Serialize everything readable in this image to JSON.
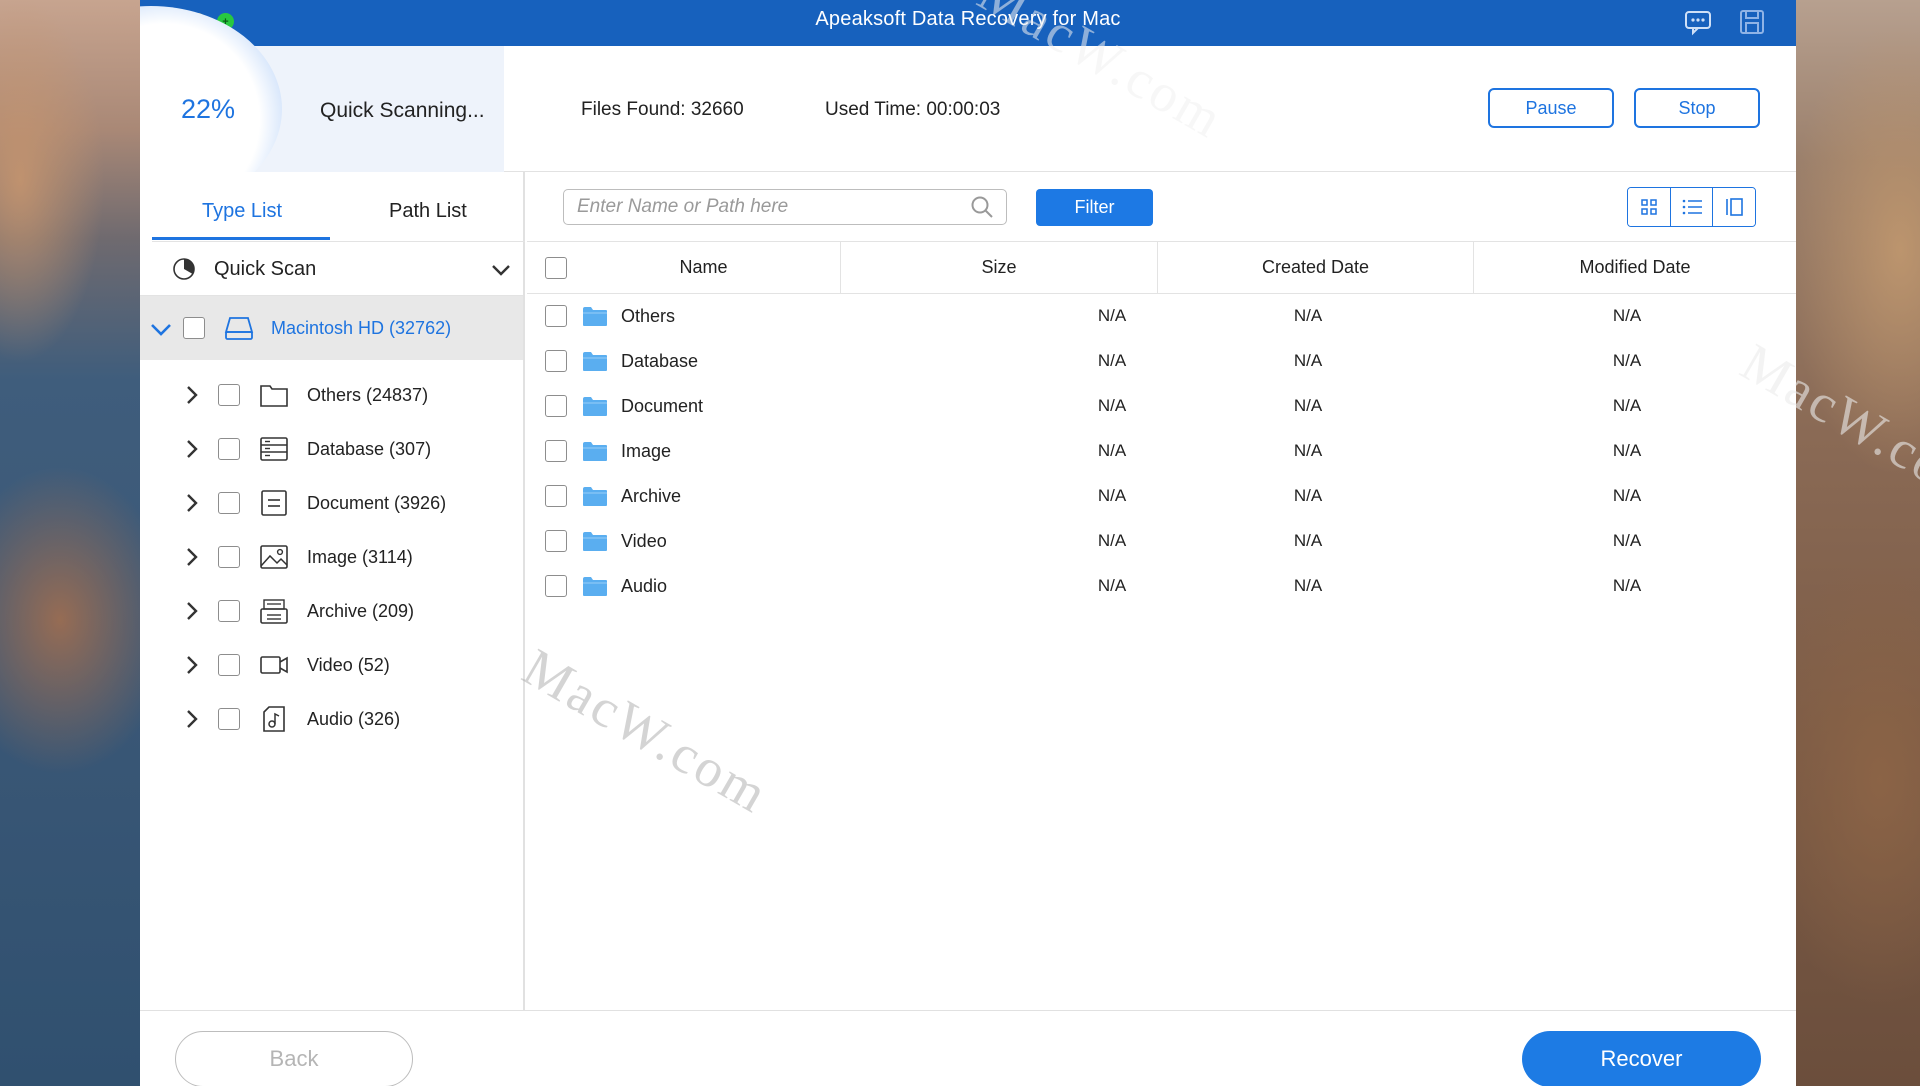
{
  "window": {
    "title": "Apeaksoft Data Recovery for Mac"
  },
  "scan": {
    "percent": "22%",
    "progress_fraction": 0.22,
    "status": "Quick Scanning...",
    "files_found": "Files Found: 32660",
    "used_time": "Used Time: 00:00:03",
    "pause_label": "Pause",
    "stop_label": "Stop"
  },
  "sidebar": {
    "tabs": [
      {
        "label": "Type List",
        "active": true
      },
      {
        "label": "Path List",
        "active": false
      }
    ],
    "mode": "Quick Scan",
    "drive": {
      "label": "Macintosh HD (32762)"
    },
    "items": [
      {
        "label": "Others (24837)",
        "icon": "folder-icon"
      },
      {
        "label": "Database (307)",
        "icon": "database-icon"
      },
      {
        "label": "Document (3926)",
        "icon": "document-icon"
      },
      {
        "label": "Image (3114)",
        "icon": "image-icon"
      },
      {
        "label": "Archive (209)",
        "icon": "archive-icon"
      },
      {
        "label": "Video (52)",
        "icon": "video-icon"
      },
      {
        "label": "Audio (326)",
        "icon": "audio-icon"
      }
    ]
  },
  "toolbar": {
    "search_placeholder": "Enter Name or Path here",
    "filter_label": "Filter"
  },
  "table": {
    "columns": [
      "Name",
      "Size",
      "Created Date",
      "Modified Date"
    ],
    "rows": [
      {
        "name": "Others",
        "size": "N/A",
        "created": "N/A",
        "modified": "N/A"
      },
      {
        "name": "Database",
        "size": "N/A",
        "created": "N/A",
        "modified": "N/A"
      },
      {
        "name": "Document",
        "size": "N/A",
        "created": "N/A",
        "modified": "N/A"
      },
      {
        "name": "Image",
        "size": "N/A",
        "created": "N/A",
        "modified": "N/A"
      },
      {
        "name": "Archive",
        "size": "N/A",
        "created": "N/A",
        "modified": "N/A"
      },
      {
        "name": "Video",
        "size": "N/A",
        "created": "N/A",
        "modified": "N/A"
      },
      {
        "name": "Audio",
        "size": "N/A",
        "created": "N/A",
        "modified": "N/A"
      }
    ]
  },
  "footer": {
    "back_label": "Back",
    "recover_label": "Recover"
  },
  "watermark": "MacW.com",
  "colors": {
    "accent": "#1e74e0",
    "titlebar": "#1761bd",
    "folder": "#5aaef0"
  }
}
